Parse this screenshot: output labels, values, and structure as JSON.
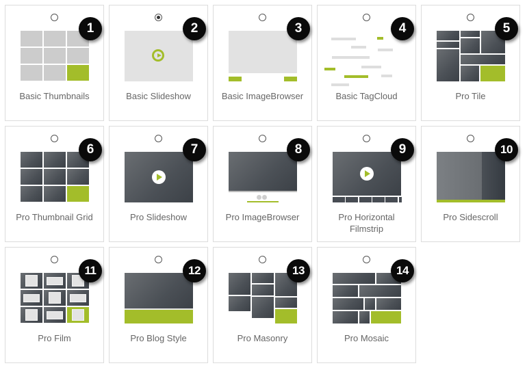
{
  "gallery_types": {
    "selected": 2,
    "items": [
      {
        "number": "1",
        "label": "Basic Thumbnails",
        "preview": "basic-thumbnails",
        "selected": false
      },
      {
        "number": "2",
        "label": "Basic Slideshow",
        "preview": "basic-slideshow",
        "selected": true
      },
      {
        "number": "3",
        "label": "Basic ImageBrowser",
        "preview": "basic-imagebrowser",
        "selected": false
      },
      {
        "number": "4",
        "label": "Basic TagCloud",
        "preview": "basic-tagcloud",
        "selected": false
      },
      {
        "number": "5",
        "label": "Pro Tile",
        "preview": "pro-tile",
        "selected": false
      },
      {
        "number": "6",
        "label": "Pro Thumbnail Grid",
        "preview": "pro-thumbnail-grid",
        "selected": false
      },
      {
        "number": "7",
        "label": "Pro Slideshow",
        "preview": "pro-slideshow",
        "selected": false
      },
      {
        "number": "8",
        "label": "Pro ImageBrowser",
        "preview": "pro-imagebrowser",
        "selected": false
      },
      {
        "number": "9",
        "label": "Pro Horizontal Filmstrip",
        "preview": "pro-horizontal-filmstrip",
        "selected": false
      },
      {
        "number": "10",
        "label": "Pro Sidescroll",
        "preview": "pro-sidescroll",
        "selected": false
      },
      {
        "number": "11",
        "label": "Pro Film",
        "preview": "pro-film",
        "selected": false
      },
      {
        "number": "12",
        "label": "Pro Blog Style",
        "preview": "pro-blog-style",
        "selected": false
      },
      {
        "number": "13",
        "label": "Pro Masonry",
        "preview": "pro-masonry",
        "selected": false
      },
      {
        "number": "14",
        "label": "Pro Mosaic",
        "preview": "pro-mosaic",
        "selected": false
      }
    ]
  },
  "colors": {
    "accent": "#a3bd2a",
    "badge": "#0a0a0a",
    "card_border": "#dcdcdc",
    "label_text": "#666666"
  }
}
